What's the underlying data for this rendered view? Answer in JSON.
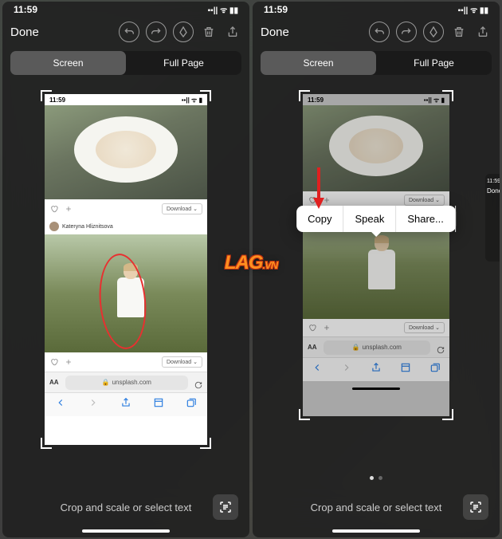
{
  "statusbar": {
    "time": "11:59",
    "indicators": "▪▪|| ᯤ ▮▮"
  },
  "toolbar": {
    "done": "Done"
  },
  "segmented": {
    "screen": "Screen",
    "fullpage": "Full Page"
  },
  "screenshot": {
    "time": "11:59",
    "indicators": "▪▪|| ᯤ ▮",
    "author": "Kateryna Hliznitsova",
    "download": "Download",
    "url": "unsplash.com",
    "url_prefix": "🔒",
    "aa": "AA"
  },
  "contextmenu": {
    "copy": "Copy",
    "speak": "Speak",
    "share": "Share..."
  },
  "hint": "Crop and scale or select text",
  "sidetab": {
    "time": "11:59",
    "done": "Done"
  },
  "watermark": {
    "main": "LAG",
    "suffix": ".VN"
  }
}
